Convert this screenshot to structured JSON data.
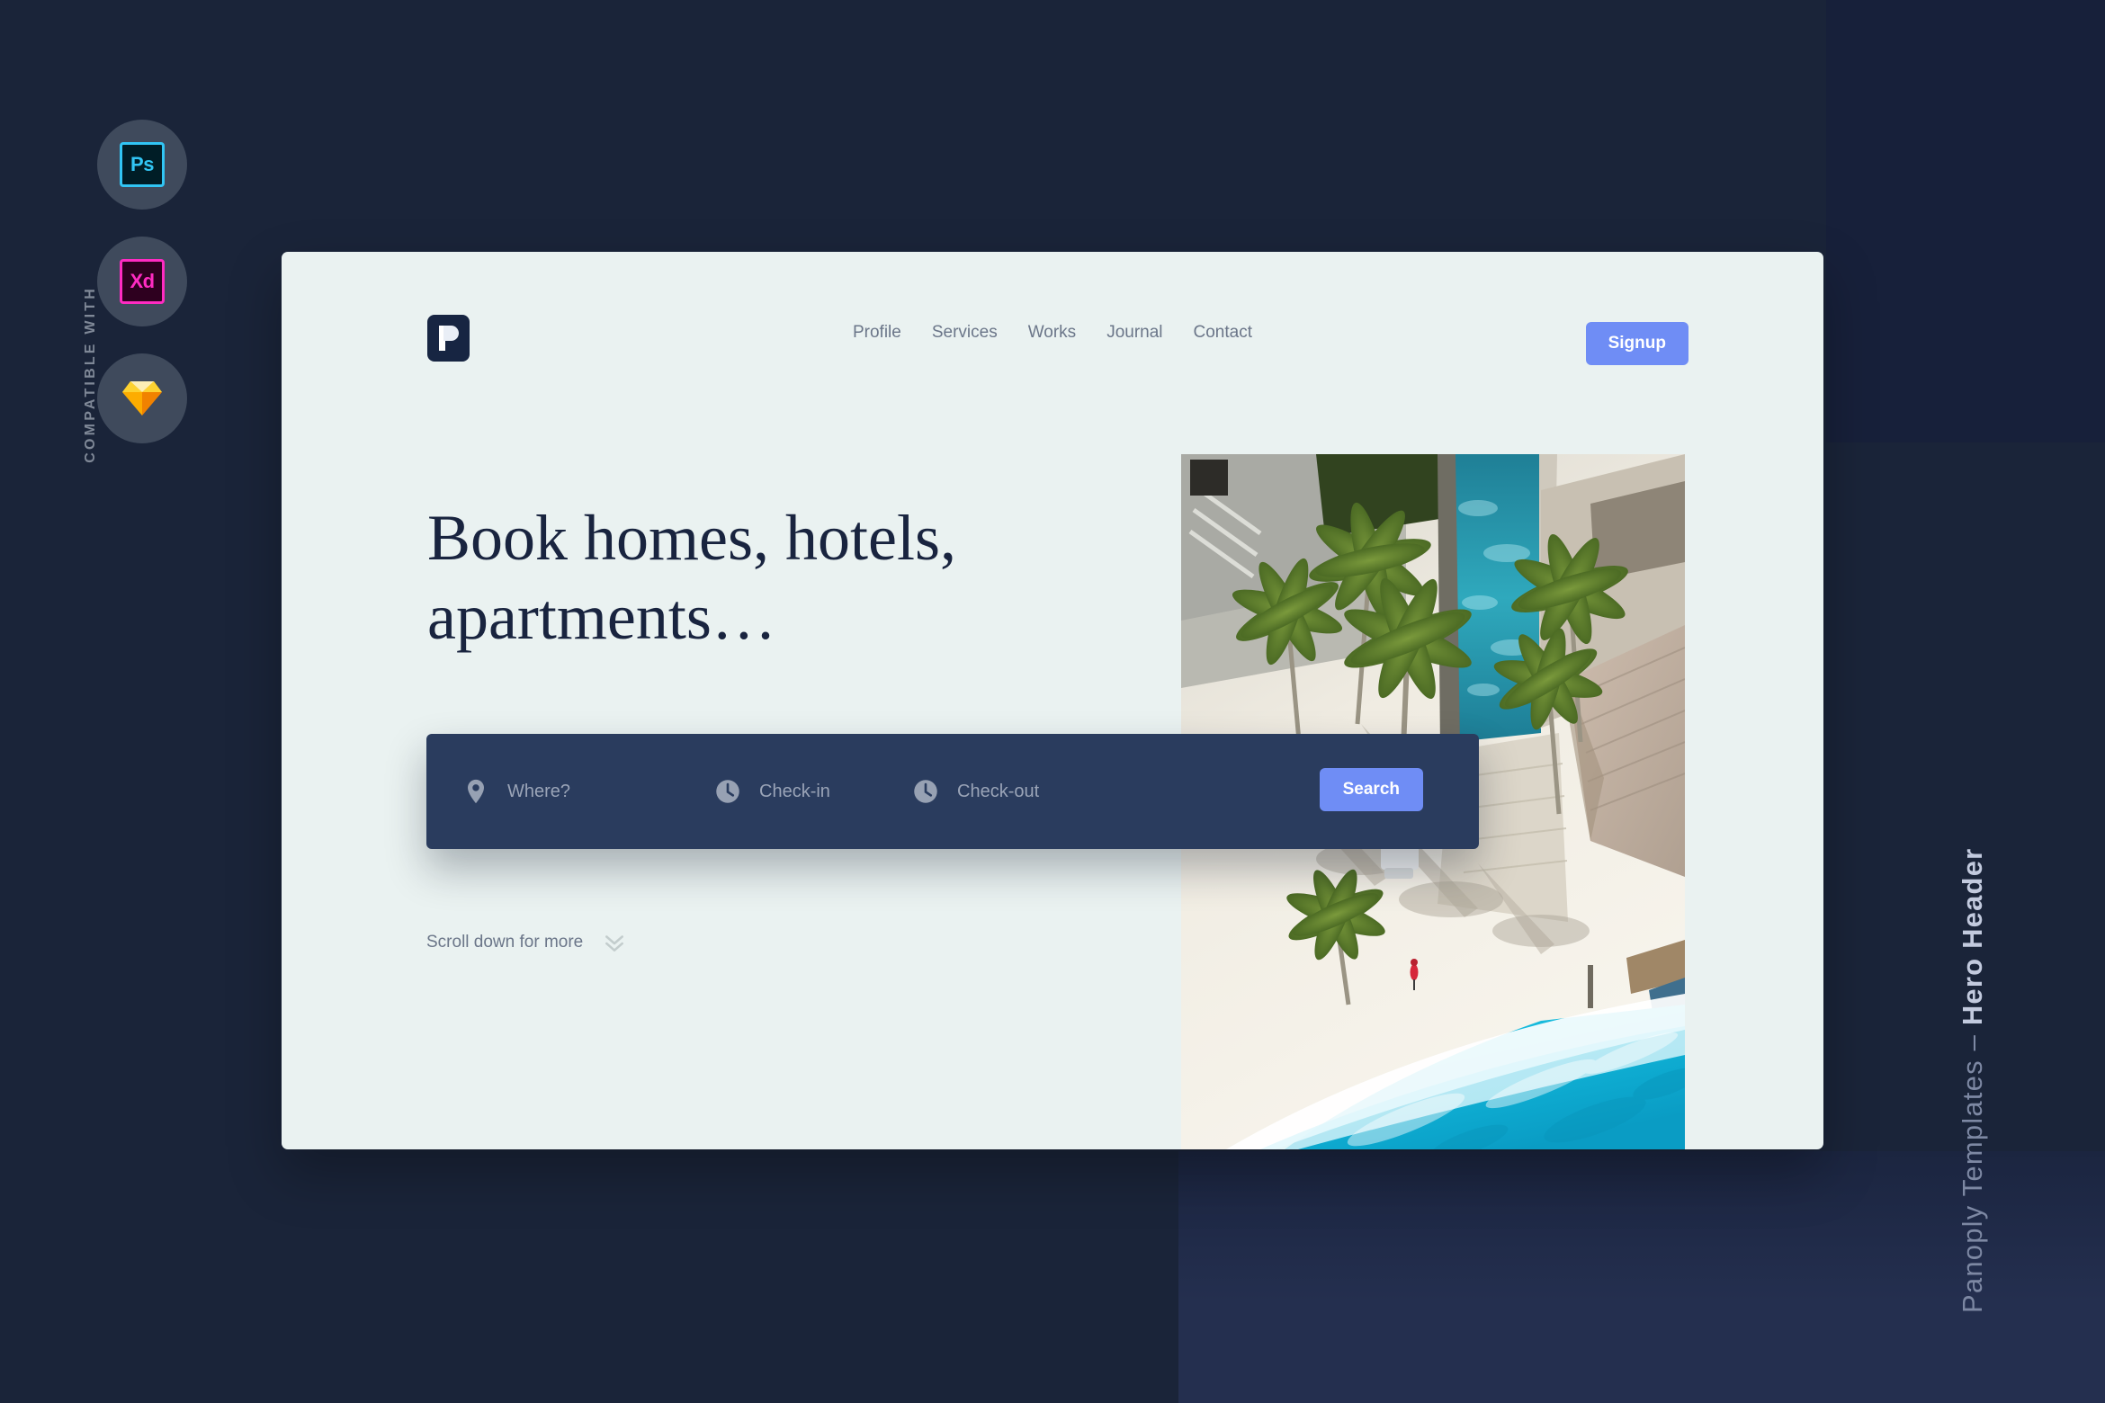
{
  "background": {
    "color": "#1a2439",
    "panel_color": "#242f4f"
  },
  "left_rail": {
    "label": "COMPATIBLE WITH",
    "apps": [
      {
        "name": "Adobe Photoshop",
        "short": "Ps",
        "icon": "photoshop-icon",
        "color": "#31c5f4"
      },
      {
        "name": "Adobe XD",
        "short": "Xd",
        "icon": "xd-icon",
        "color": "#ff2bc2"
      },
      {
        "name": "Sketch",
        "short": "",
        "icon": "sketch-icon",
        "color": "#fdad00"
      }
    ]
  },
  "side_caption": {
    "prefix": "Panoply Templates – ",
    "emphasis": "Hero Header"
  },
  "card": {
    "background": "#eaf2f1",
    "header": {
      "logo_icon": "panoply-logo-icon",
      "nav": [
        {
          "label": "Profile"
        },
        {
          "label": "Services"
        },
        {
          "label": "Works"
        },
        {
          "label": "Journal"
        },
        {
          "label": "Contact"
        }
      ],
      "signup_label": "Signup",
      "accent_color": "#6f8df5"
    },
    "hero": {
      "headline": "Book homes, hotels, apartments…",
      "photo_alt": "Aerial view of tropical resort with palm trees, pool and turquoise beach"
    },
    "search": {
      "background": "#2a3c5e",
      "fields": [
        {
          "icon": "map-pin-icon",
          "placeholder": "Where?"
        },
        {
          "icon": "clock-icon",
          "placeholder": "Check-in"
        },
        {
          "icon": "clock-icon",
          "placeholder": "Check-out"
        }
      ],
      "button_label": "Search"
    },
    "scroll_hint": {
      "label": "Scroll down for more",
      "icon": "double-chevron-down-icon"
    }
  }
}
